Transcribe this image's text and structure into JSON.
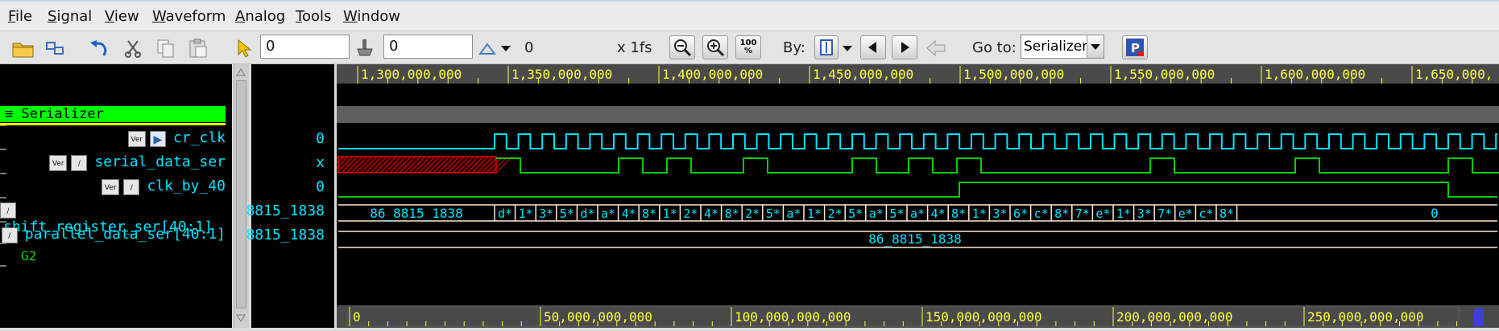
{
  "menu": [
    "File",
    "Signal",
    "View",
    "Waveform",
    "Analog",
    "Tools",
    "Window"
  ],
  "menu_mnemonic": [
    "F",
    "S",
    "V",
    "W",
    "A",
    "T",
    "W"
  ],
  "toolbar": {
    "time_field": "0",
    "delta_field": "0",
    "delta_value": "0",
    "scale": "x 1fs",
    "zoom_full_label": "100\n%",
    "by_label": "By:",
    "goto_label": "Go to:",
    "goto_value": "Serializer"
  },
  "signals": {
    "group_name": "≡ Serializer",
    "rows": [
      {
        "name": "cr_clk",
        "value": "0"
      },
      {
        "name": "serial_data_ser",
        "value": "x"
      },
      {
        "name": "clk_by_40",
        "value": "0"
      },
      {
        "name": "shift_register_ser[40:1]",
        "value": "8815_1838"
      },
      {
        "name": "parallel_data_ser[40:1]",
        "value": "8815_1838"
      }
    ],
    "group2_name": "G2"
  },
  "waveform": {
    "top_ruler": [
      "1,300,000,000",
      "1,350,000,000",
      "1,400,000,000",
      "1,450,000,000",
      "1,500,000,000",
      "1,550,000,000",
      "1,600,000,000",
      "1,650,000,"
    ],
    "bottom_ruler": [
      "0",
      "50,000,000,000",
      "100,000,000,000",
      "150,000,000,000",
      "200,000,000,000",
      "250,000,000,000"
    ],
    "shift_first": "86_8815_1838",
    "shift_segments": [
      "d*",
      "1*",
      "3*",
      "5*",
      "d*",
      "a*",
      "4*",
      "8*",
      "1*",
      "2*",
      "4*",
      "8*",
      "2*",
      "5*",
      "a*",
      "1*",
      "2*",
      "5*",
      "a*",
      "5*",
      "a*",
      "4*",
      "8*",
      "1*",
      "3*",
      "6*",
      "c*",
      "8*",
      "7*",
      "e*",
      "1*",
      "3*",
      "7*",
      "e*",
      "c*",
      "8*"
    ],
    "shift_last": "0",
    "parallel_value": "86_8815_1838"
  },
  "colors": {
    "clock": "#00e5ff",
    "signal": "#00d000",
    "ruler": "#ffff40",
    "group_highlight": "#00ff00",
    "unknown": "#e00000"
  },
  "icons": [
    "open-folder-icon",
    "reload-icon",
    "undo-icon",
    "cut-icon",
    "copy-icon",
    "paste-icon",
    "cursor-icon",
    "marker-icon",
    "delta-triangle-icon",
    "zoom-out-icon",
    "zoom-in-icon",
    "zoom-full-icon",
    "edge-select-icon",
    "prev-edge-icon",
    "next-edge-icon",
    "back-icon",
    "palette-icon"
  ]
}
